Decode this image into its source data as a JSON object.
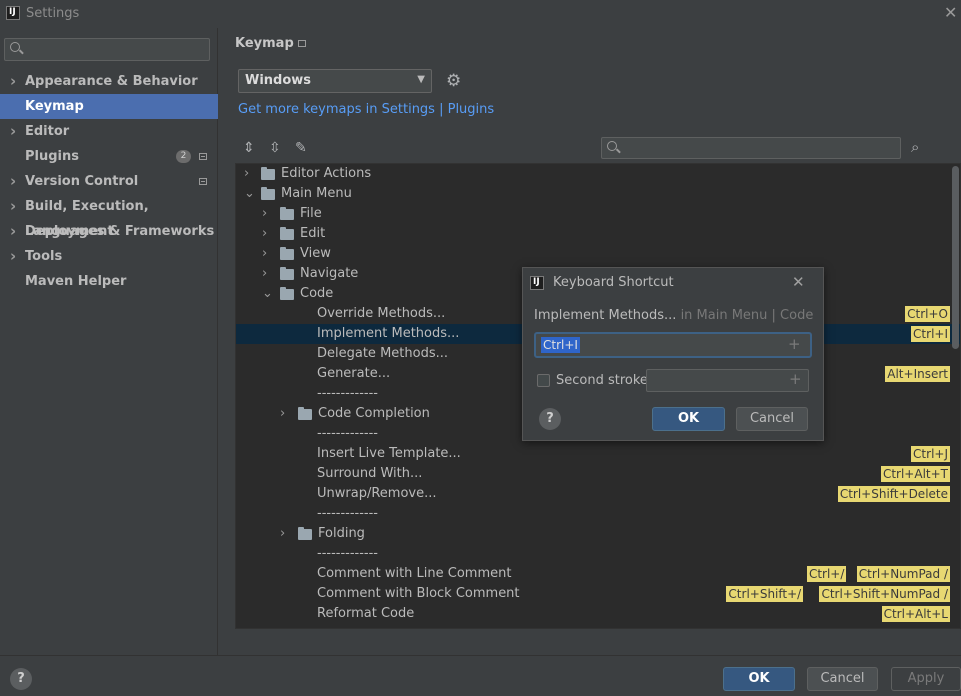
{
  "window": {
    "title": "Settings",
    "logo": "IJ"
  },
  "sidebar": {
    "search_placeholder": "",
    "items": [
      {
        "label": "Appearance & Behavior",
        "expandable": true
      },
      {
        "label": "Keymap",
        "selected": true
      },
      {
        "label": "Editor",
        "expandable": true
      },
      {
        "label": "Plugins",
        "badge": "2"
      },
      {
        "label": "Version Control",
        "expandable": true
      },
      {
        "label": "Build, Execution, Deployment",
        "expandable": true
      },
      {
        "label": "Languages & Frameworks",
        "expandable": true
      },
      {
        "label": "Tools",
        "expandable": true
      },
      {
        "label": "Maven Helper"
      }
    ]
  },
  "main": {
    "title": "Keymap",
    "keymap_select": "Windows",
    "get_more_link": "Get more keymaps in Settings | Plugins",
    "tree": [
      {
        "label": "Editor Actions",
        "level": 0,
        "expandable": true,
        "expanded": false,
        "icon": "editor-actions-icon"
      },
      {
        "label": "Main Menu",
        "level": 0,
        "expandable": true,
        "expanded": true,
        "icon": "main-menu-icon"
      },
      {
        "label": "File",
        "level": 1,
        "expandable": true,
        "expanded": false,
        "icon": "folder-icon"
      },
      {
        "label": "Edit",
        "level": 1,
        "expandable": true,
        "expanded": false,
        "icon": "folder-icon"
      },
      {
        "label": "View",
        "level": 1,
        "expandable": true,
        "expanded": false,
        "icon": "folder-icon"
      },
      {
        "label": "Navigate",
        "level": 1,
        "expandable": true,
        "expanded": false,
        "icon": "folder-icon"
      },
      {
        "label": "Code",
        "level": 1,
        "expandable": true,
        "expanded": true,
        "icon": "folder-icon"
      },
      {
        "label": "Override Methods...",
        "level": 2,
        "shortcuts": [
          "Ctrl+O"
        ]
      },
      {
        "label": "Implement Methods...",
        "level": 2,
        "shortcuts": [
          "Ctrl+I"
        ],
        "selected": true
      },
      {
        "label": "Delegate Methods...",
        "level": 2,
        "shortcuts": []
      },
      {
        "label": "Generate...",
        "level": 2,
        "shortcuts": [
          "Alt+Insert"
        ]
      },
      {
        "label": "-------------",
        "level": 2,
        "shortcuts": []
      },
      {
        "label": "Code Completion",
        "level": 2,
        "expandable": true,
        "expanded": false,
        "icon": "folder-icon"
      },
      {
        "label": "-------------",
        "level": 2,
        "shortcuts": []
      },
      {
        "label": "Insert Live Template...",
        "level": 2,
        "shortcuts": [
          "Ctrl+J"
        ]
      },
      {
        "label": "Surround With...",
        "level": 2,
        "shortcuts": [
          "Ctrl+Alt+T"
        ]
      },
      {
        "label": "Unwrap/Remove...",
        "level": 2,
        "shortcuts": [
          "Ctrl+Shift+Delete"
        ]
      },
      {
        "label": "-------------",
        "level": 2,
        "shortcuts": []
      },
      {
        "label": "Folding",
        "level": 2,
        "expandable": true,
        "expanded": false,
        "icon": "folder-icon"
      },
      {
        "label": "-------------",
        "level": 2,
        "shortcuts": []
      },
      {
        "label": "Comment with Line Comment",
        "level": 2,
        "shortcuts": [
          "Ctrl+/",
          "Ctrl+NumPad /"
        ]
      },
      {
        "label": "Comment with Block Comment",
        "level": 2,
        "shortcuts": [
          "Ctrl+Shift+/",
          "Ctrl+Shift+NumPad /"
        ]
      },
      {
        "label": "Reformat Code",
        "level": 2,
        "shortcuts": [
          "Ctrl+Alt+L"
        ]
      }
    ]
  },
  "dialog": {
    "title": "Keyboard Shortcut",
    "action_name": "Implement Methods...",
    "action_path": "in Main Menu | Code",
    "first_stroke": "Ctrl+I",
    "second_stroke_label": "Second stroke:",
    "second_stroke_checked": false,
    "ok": "OK",
    "cancel": "Cancel",
    "help": "?"
  },
  "footer": {
    "ok": "OK",
    "cancel": "Cancel",
    "apply": "Apply",
    "help": "?"
  },
  "colors": {
    "selection": "#4b6eaf",
    "shortcut_bg": "#e8d872",
    "link": "#589df6",
    "primary_button": "#365880"
  }
}
